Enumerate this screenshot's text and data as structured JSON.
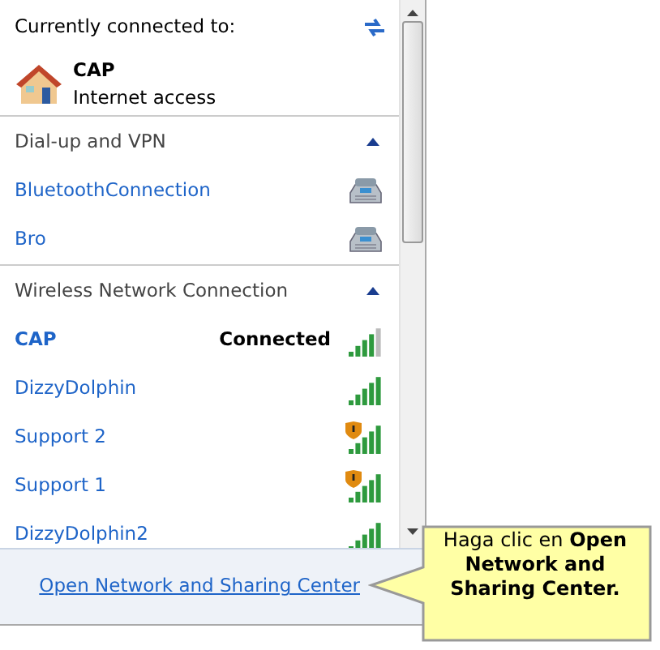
{
  "current": {
    "heading": "Currently connected to:",
    "name": "CAP",
    "status": "Internet access"
  },
  "sections": [
    {
      "title": "Dial-up and VPN",
      "expanded": true,
      "items": [
        {
          "kind": "dialup",
          "name": "BluetoothConnection",
          "connected": false
        },
        {
          "kind": "dialup",
          "name": "Bro",
          "connected": false
        }
      ]
    },
    {
      "title": "Wireless Network Connection",
      "expanded": true,
      "items": [
        {
          "kind": "wifi",
          "name": "CAP",
          "connected": true,
          "status": "Connected",
          "warning": false
        },
        {
          "kind": "wifi",
          "name": "DizzyDolphin",
          "connected": false,
          "warning": false
        },
        {
          "kind": "wifi",
          "name": "Support 2",
          "connected": false,
          "warning": true
        },
        {
          "kind": "wifi",
          "name": "Support 1",
          "connected": false,
          "warning": true
        },
        {
          "kind": "wifi",
          "name": "DizzyDolphin2",
          "connected": false,
          "warning": false
        }
      ]
    }
  ],
  "footer_link": "Open Network and Sharing Center",
  "callout": "Haga clic en **Open Network and Sharing Center.**"
}
